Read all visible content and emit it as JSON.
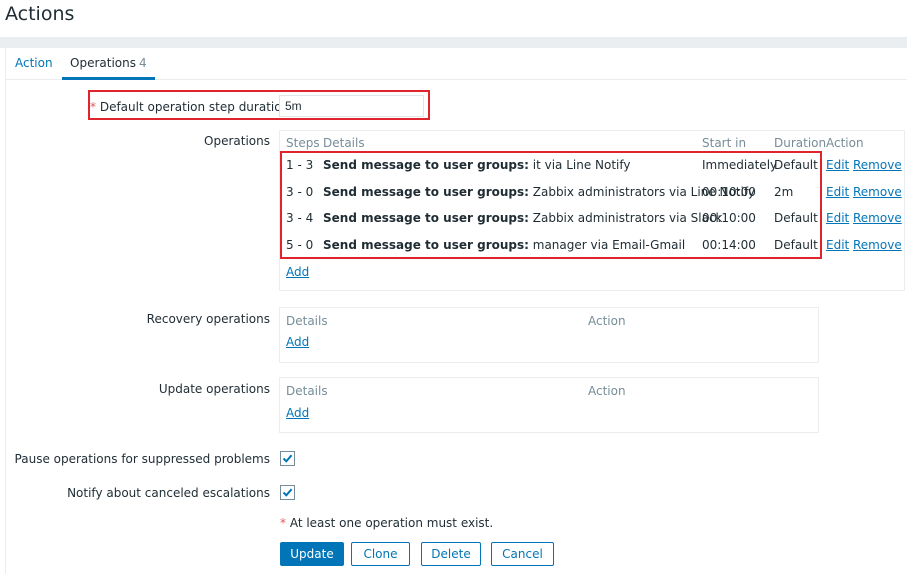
{
  "page": {
    "title": "Actions"
  },
  "tabs": [
    {
      "label": "Action"
    },
    {
      "label": "Operations",
      "count": "4"
    }
  ],
  "step_duration": {
    "required_mark": "*",
    "label": "Default operation step duration",
    "value": "5m"
  },
  "operations": {
    "label": "Operations",
    "headers": {
      "steps": "Steps",
      "details": "Details",
      "start_in": "Start in",
      "duration": "Duration",
      "action": "Action"
    },
    "rows": [
      {
        "steps": "1 - 3",
        "details_prefix": "Send message to user groups:",
        "details_rest": " it via Line Notify",
        "start_in": "Immediately",
        "duration": "Default",
        "edit": "Edit",
        "remove": "Remove"
      },
      {
        "steps": "3 - 0",
        "details_prefix": "Send message to user groups:",
        "details_rest": " Zabbix administrators via Line Notify",
        "start_in": "00:10:00",
        "duration": "2m",
        "edit": "Edit",
        "remove": "Remove"
      },
      {
        "steps": "3 - 4",
        "details_prefix": "Send message to user groups:",
        "details_rest": " Zabbix administrators via Slack",
        "start_in": "00:10:00",
        "duration": "Default",
        "edit": "Edit",
        "remove": "Remove"
      },
      {
        "steps": "5 - 0",
        "details_prefix": "Send message to user groups:",
        "details_rest": " manager via Email-Gmail",
        "start_in": "00:14:00",
        "duration": "Default",
        "edit": "Edit",
        "remove": "Remove"
      }
    ],
    "add_label": "Add"
  },
  "recovery_operations": {
    "label": "Recovery operations",
    "headers": {
      "details": "Details",
      "action": "Action"
    },
    "add_label": "Add"
  },
  "update_operations": {
    "label": "Update operations",
    "headers": {
      "details": "Details",
      "action": "Action"
    },
    "add_label": "Add"
  },
  "pause_suppressed": {
    "label": "Pause operations for suppressed problems",
    "checked": true
  },
  "notify_canceled": {
    "label": "Notify about canceled escalations",
    "checked": true
  },
  "validation_note": {
    "mark": "*",
    "text": " At least one operation must exist."
  },
  "buttons": {
    "update": "Update",
    "clone": "Clone",
    "delete": "Delete",
    "cancel": "Cancel"
  },
  "colors": {
    "accent": "#0275b8",
    "required": "#e45959",
    "highlight_border": "#e0242e"
  }
}
